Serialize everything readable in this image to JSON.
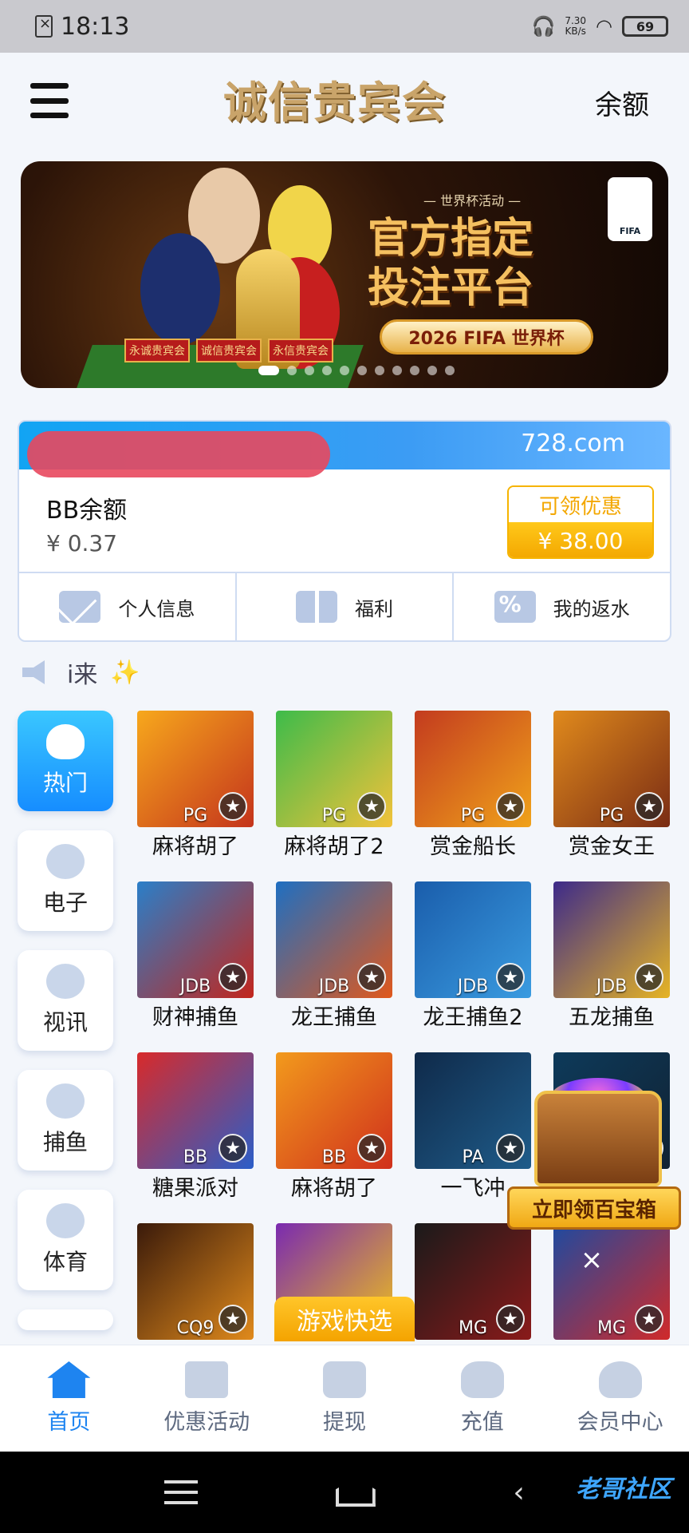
{
  "status_bar": {
    "time": "18:13",
    "net_speed": "7.30",
    "net_unit": "KB/s",
    "battery": "69"
  },
  "header": {
    "logo_text": "诚信贵宾会",
    "balance_label": "余额"
  },
  "banner": {
    "event_label": "— 世界杯活动 —",
    "headline_line1": "官方指定",
    "headline_line2": "投注平台",
    "pill_text": "2026 FIFA 世界杯",
    "fifa_badge": "FIFA",
    "tags": [
      "永诚贵宾会",
      "诚信贵宾会",
      "永信贵宾会"
    ],
    "slide_count": 11,
    "active_slide": 0
  },
  "account": {
    "domain": "728.com",
    "balance_label": "BB余额",
    "balance_value": "¥ 0.37",
    "promo_title": "可领优惠",
    "promo_value": "¥ 38.00"
  },
  "shortcuts": [
    {
      "label": "个人信息",
      "icon": "mail-icon"
    },
    {
      "label": "福利",
      "icon": "gift-icon"
    },
    {
      "label": "我的返水",
      "icon": "rebate-icon"
    }
  ],
  "notice": {
    "text": "i来",
    "icon": "speaker-icon"
  },
  "categories": [
    {
      "label": "热门",
      "icon": "flame-icon",
      "active": true
    },
    {
      "label": "电子",
      "icon": "slot-icon"
    },
    {
      "label": "视讯",
      "icon": "chip-icon"
    },
    {
      "label": "捕鱼",
      "icon": "fish-icon"
    },
    {
      "label": "体育",
      "icon": "soccer-ball-icon"
    }
  ],
  "games": [
    {
      "name": "麻将胡了",
      "vendor": "PG",
      "colors": [
        "#f7a81c",
        "#c4341c"
      ]
    },
    {
      "name": "麻将胡了2",
      "vendor": "PG",
      "colors": [
        "#3dbb4a",
        "#f2c23a"
      ]
    },
    {
      "name": "赏金船长",
      "vendor": "PG",
      "colors": [
        "#c33b1f",
        "#f0a21a"
      ]
    },
    {
      "name": "赏金女王",
      "vendor": "PG",
      "colors": [
        "#e08a1c",
        "#7a2c14"
      ]
    },
    {
      "name": "财神捕鱼",
      "vendor": "JDB",
      "colors": [
        "#2a7fc9",
        "#c2261d"
      ]
    },
    {
      "name": "龙王捕鱼",
      "vendor": "JDB",
      "colors": [
        "#1e6fc2",
        "#e0581c"
      ]
    },
    {
      "name": "龙王捕鱼2",
      "vendor": "JDB",
      "colors": [
        "#1a5dab",
        "#3a9be0"
      ]
    },
    {
      "name": "五龙捕鱼",
      "vendor": "JDB",
      "colors": [
        "#3d2a8a",
        "#e6b424"
      ]
    },
    {
      "name": "糖果派对",
      "vendor": "BB",
      "colors": [
        "#d82a2a",
        "#2a5ec9"
      ]
    },
    {
      "name": "麻将胡了",
      "vendor": "BB",
      "colors": [
        "#f29a1c",
        "#d0301c"
      ]
    },
    {
      "name": "一飞冲",
      "vendor": "PA",
      "colors": [
        "#0f2a4a",
        "#1f5c8a"
      ]
    },
    {
      "name": "",
      "vendor": "",
      "colors": [
        "#0d3a5a",
        "#123"
      ]
    },
    {
      "name": "",
      "vendor": "CQ9",
      "colors": [
        "#3a1a0a",
        "#e08a1c"
      ]
    },
    {
      "name": "",
      "vendor": "",
      "colors": [
        "#7a2ab0",
        "#f0c21a"
      ]
    },
    {
      "name": "",
      "vendor": "MG",
      "colors": [
        "#1a1a1a",
        "#8a1a1a"
      ]
    },
    {
      "name": "",
      "vendor": "MG",
      "colors": [
        "#1e4aa0",
        "#d02a2a"
      ]
    }
  ],
  "floaters": {
    "chest_button": "立即领百宝箱",
    "quick_pick": "游戏快选",
    "close": "×"
  },
  "bottom_nav": [
    {
      "label": "首页",
      "icon": "home-icon",
      "active": true
    },
    {
      "label": "优惠活动",
      "icon": "gift-icon"
    },
    {
      "label": "提现",
      "icon": "card-icon"
    },
    {
      "label": "充值",
      "icon": "money-bag-icon"
    },
    {
      "label": "会员中心",
      "icon": "user-icon"
    }
  ],
  "watermark": "老哥社区"
}
